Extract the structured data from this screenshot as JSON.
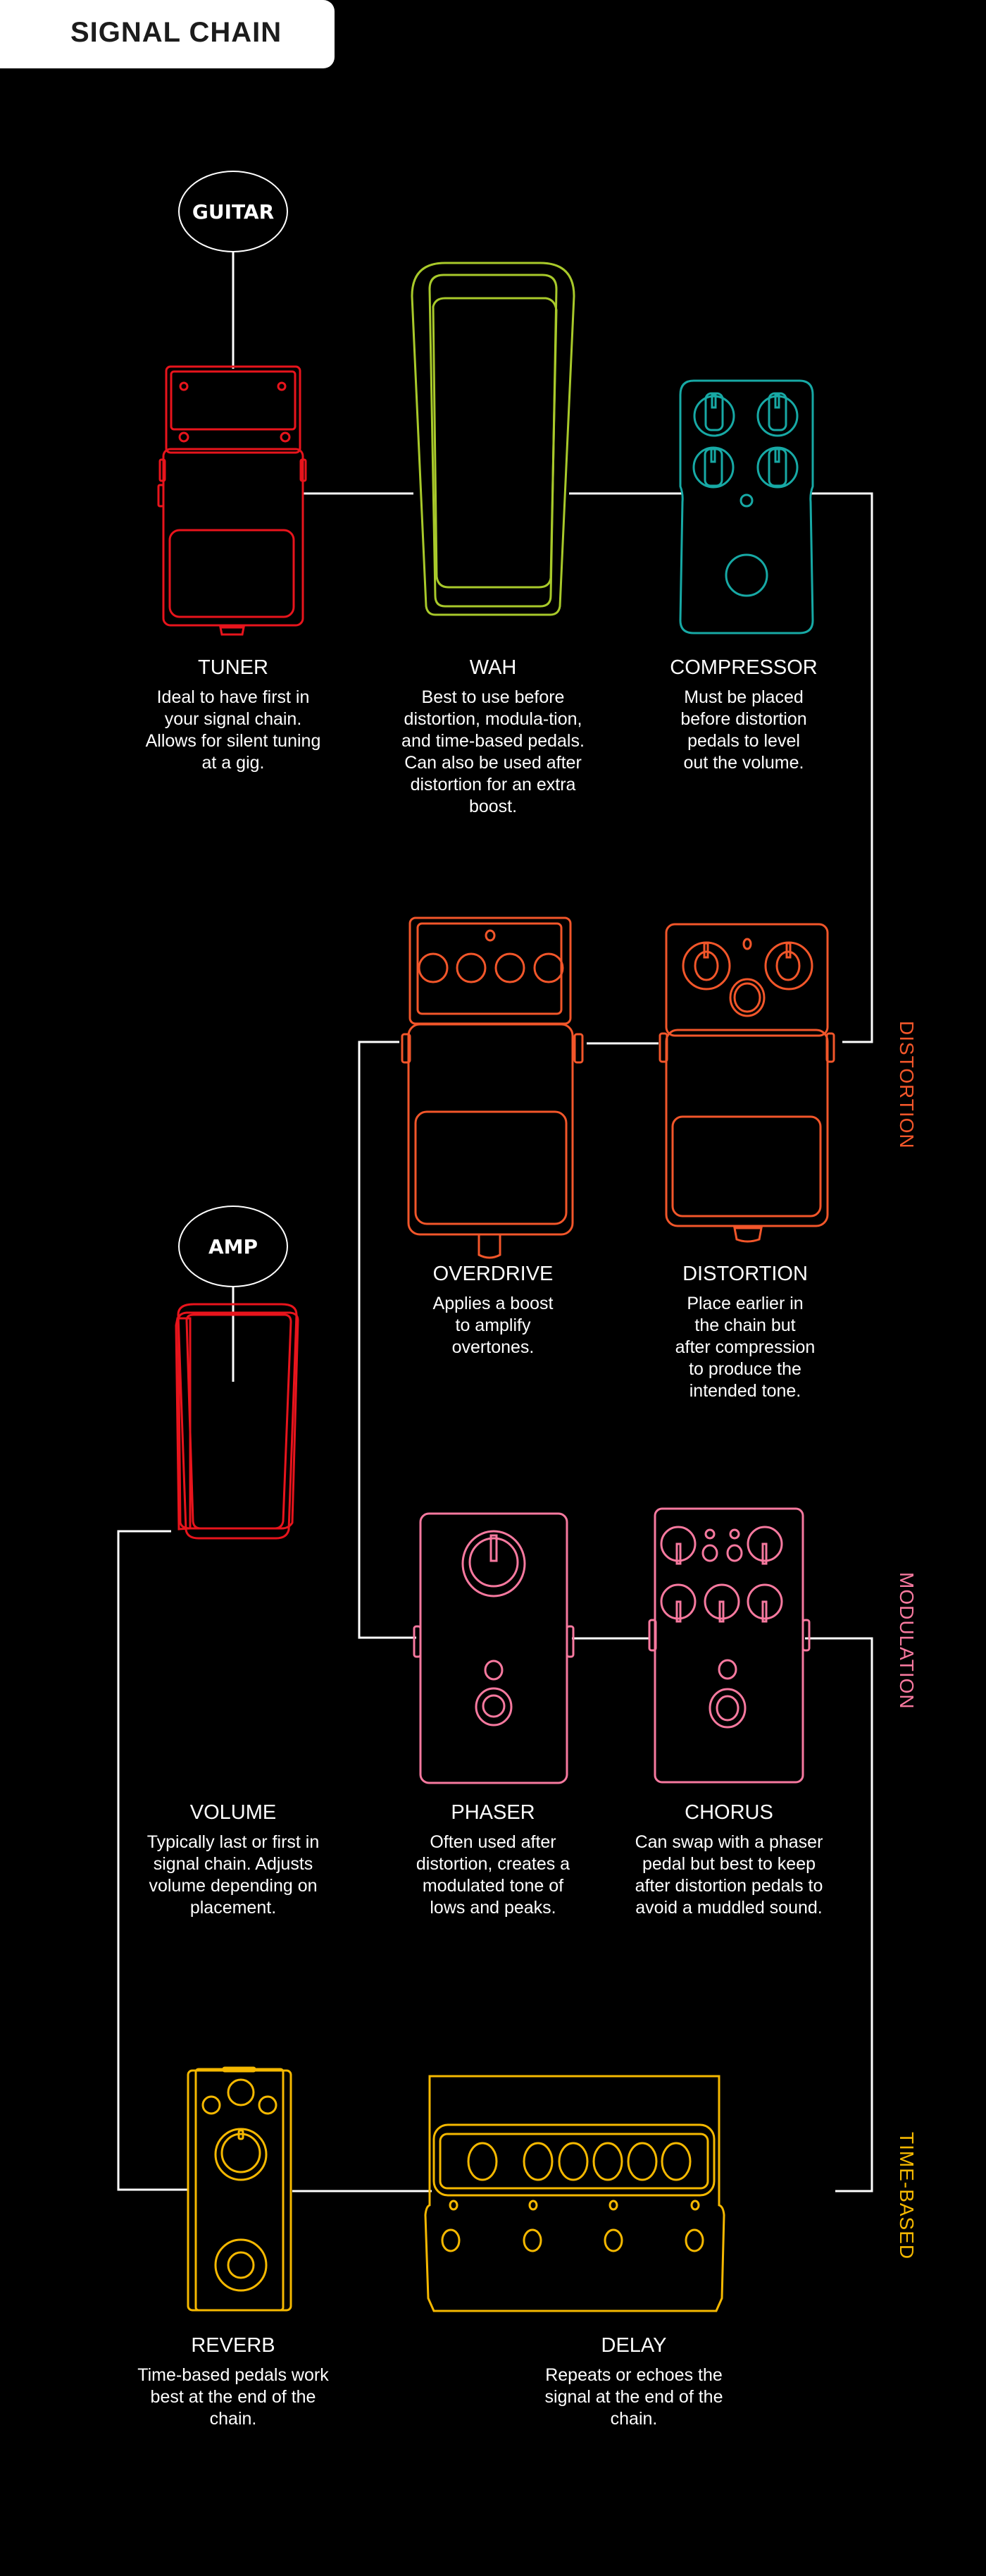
{
  "title": "SIGNAL CHAIN",
  "nodes": {
    "start": "GUITAR",
    "end": "AMP"
  },
  "colors": {
    "background": "#000000",
    "wire": "#ffffff",
    "tuner": "#e8141c",
    "wah": "#a8c92a",
    "compressor": "#17a9a5",
    "distortion_group": "#f2562a",
    "modulation_group": "#f7799f",
    "time_based_group": "#f5b800",
    "volume": "#e8141c"
  },
  "categories": {
    "distortion": "DISTORTION",
    "modulation": "MODULATION",
    "time_based": "TIME-BASED"
  },
  "pedals": {
    "tuner": {
      "name": "TUNER",
      "desc": "Ideal to have first in your signal chain. Allows for silent tuning at a gig."
    },
    "wah": {
      "name": "WAH",
      "desc": "Best to use before distortion, modula-tion, and time-based pedals. Can also be used after distortion for an extra boost."
    },
    "compressor": {
      "name": "COMPRESSOR",
      "desc": "Must be placed before distortion pedals to level out the volume."
    },
    "overdrive": {
      "name": "OVERDRIVE",
      "desc": "Applies a boost to amplify overtones."
    },
    "distortion": {
      "name": "DISTORTION",
      "desc": "Place earlier in the chain but after compression to produce the intended tone."
    },
    "volume": {
      "name": "VOLUME",
      "desc": "Typically last or first in signal chain. Adjusts volume depending on placement."
    },
    "phaser": {
      "name": "PHASER",
      "desc": "Often used after distortion, creates a modulated tone of lows and peaks."
    },
    "chorus": {
      "name": "CHORUS",
      "desc": "Can swap with a phaser pedal but best to keep after distortion pedals to avoid a muddled sound."
    },
    "reverb": {
      "name": "REVERB",
      "desc": "Time-based pedals work best at the end of the chain."
    },
    "delay": {
      "name": "DELAY",
      "desc": "Repeats or echoes the signal at the end of the chain."
    }
  },
  "chain_order": [
    "GUITAR",
    "TUNER",
    "WAH",
    "COMPRESSOR",
    "DISTORTION",
    "OVERDRIVE",
    "PHASER",
    "CHORUS",
    "DELAY",
    "REVERB",
    "VOLUME",
    "AMP"
  ]
}
